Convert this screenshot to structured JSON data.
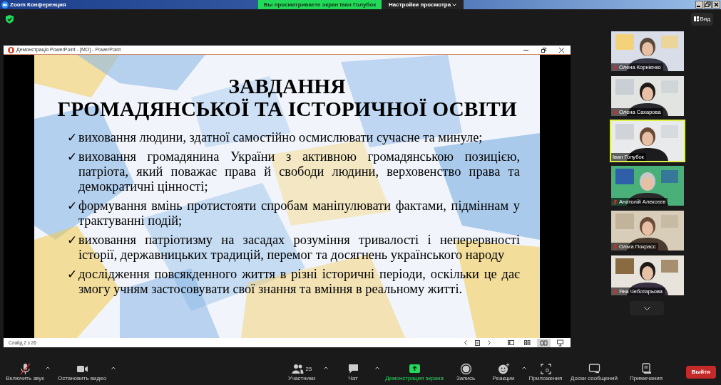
{
  "window": {
    "title": "Zoom Конференция"
  },
  "share_banner": {
    "text": "Вы просматриваете экран Іван Голубок",
    "settings": "Настройки просмотра"
  },
  "view_button": "Вид",
  "shared_window": {
    "title": "Демонстрація PowerPoint - [МО] - PowerPoint",
    "slide": {
      "title_lines": [
        "ЗАВДАННЯ",
        "ГРОМАДЯНСЬКОЇ ТА ІСТОРИЧНОЇ ОСВІТИ"
      ],
      "bullets": [
        {
          "mark": "✓",
          "text": "виховання людини, здатної самостійно осмислювати сучасне та минуле;"
        },
        {
          "mark": "✓",
          "text": "виховання громадянина України з активною громадянською позицією, патріота, який поважає права й свободи людини, верховенство права та демократичні цінності;"
        },
        {
          "mark": "✓",
          "text": "формування вмінь протистояти спробам маніпулювати фактами, підміннам у трактуванні подій;"
        },
        {
          "mark": "✓",
          "text": "виховання патріотизму на засадах розуміння тривалості і неперервності історії, державницьких традицій, перемог та досягнень українського народу"
        },
        {
          "mark": "✓",
          "text": "дослідження повсякденного життя в різні історичні періоди, оскільки це дає змогу учням застосовувати свої знання та вміння в реальному житті."
        }
      ]
    },
    "status": "Слайд 2 з 26",
    "view_buttons": [
      {
        "kind": "normal",
        "selected": false
      },
      {
        "kind": "sorter",
        "selected": false
      },
      {
        "kind": "reading",
        "selected": true
      },
      {
        "kind": "slideshow",
        "selected": false
      }
    ]
  },
  "participants": [
    {
      "name": "Олена Корнієнко",
      "muted": true,
      "selected": false
    },
    {
      "name": "Олена Сахарова",
      "muted": true,
      "selected": false
    },
    {
      "name": "Іван Голубок",
      "muted": false,
      "selected": true
    },
    {
      "name": "Анатолій Алексєєв",
      "muted": true,
      "selected": false
    },
    {
      "name": "Ольга Покрасс",
      "muted": true,
      "selected": false
    },
    {
      "name": "Яна Чеботарьова",
      "muted": true,
      "selected": false
    }
  ],
  "toolbar": [
    {
      "kind": "mic",
      "label": "Включить звук",
      "caret": true
    },
    {
      "kind": "video",
      "label": "Остановить видео",
      "caret": true
    },
    {
      "kind": "participants",
      "label": "Участники",
      "count": "25",
      "caret": true
    },
    {
      "kind": "chat",
      "label": "Чат",
      "caret": true
    },
    {
      "kind": "share",
      "label": "Демонстрация экрана",
      "caret": false
    },
    {
      "kind": "record",
      "label": "Запись",
      "caret": false
    },
    {
      "kind": "reactions",
      "label": "Реакции",
      "caret": true
    },
    {
      "kind": "apps",
      "label": "Приложения",
      "caret": false
    },
    {
      "kind": "whiteboard",
      "label": "Доски сообщений",
      "caret": false
    },
    {
      "kind": "notes",
      "label": "Примечания",
      "caret": false
    }
  ],
  "leave_button": "Выйти"
}
